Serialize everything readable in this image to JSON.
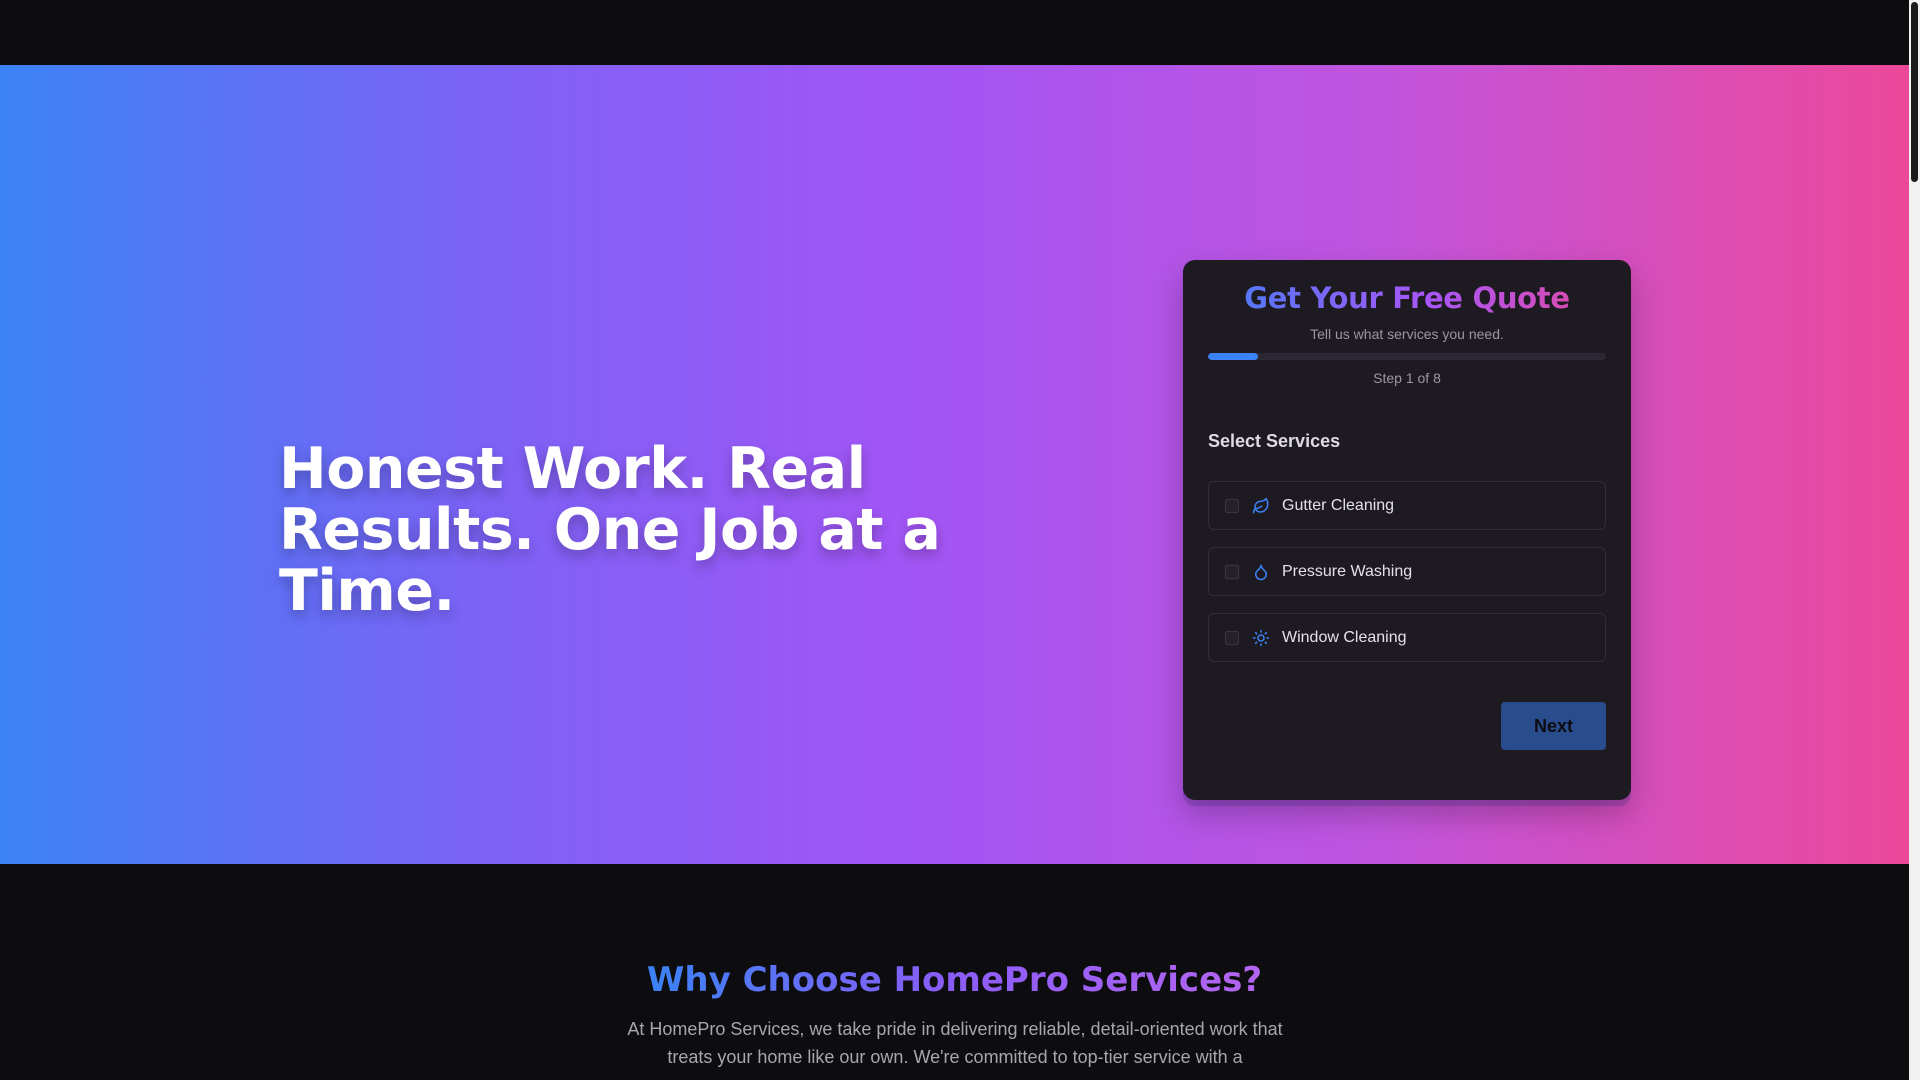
{
  "hero": {
    "headline": "Honest Work. Real Results. One Job at a Time."
  },
  "quote_form": {
    "title": "Get Your Free Quote",
    "subtitle": "Tell us what services you need.",
    "progress_fraction": 0.125,
    "step_text": "Step 1 of 8",
    "section_label": "Select Services",
    "options": [
      {
        "label": "Gutter Cleaning",
        "icon": "leaf-icon",
        "checked": false
      },
      {
        "label": "Pressure Washing",
        "icon": "droplet-icon",
        "checked": false
      },
      {
        "label": "Window Cleaning",
        "icon": "sun-icon",
        "checked": false
      }
    ],
    "next_label": "Next"
  },
  "about": {
    "title": "Why Choose HomePro Services?",
    "body": "At HomePro Services, we take pride in delivering reliable, detail-oriented work that treats your home like our own. We're committed to top-tier service with a"
  },
  "colors": {
    "accent_blue": "#3b82f6",
    "accent_purple": "#a855f7",
    "accent_pink": "#ec4899",
    "card_bg": "#1e1a22",
    "page_bg": "#0d0d10"
  }
}
